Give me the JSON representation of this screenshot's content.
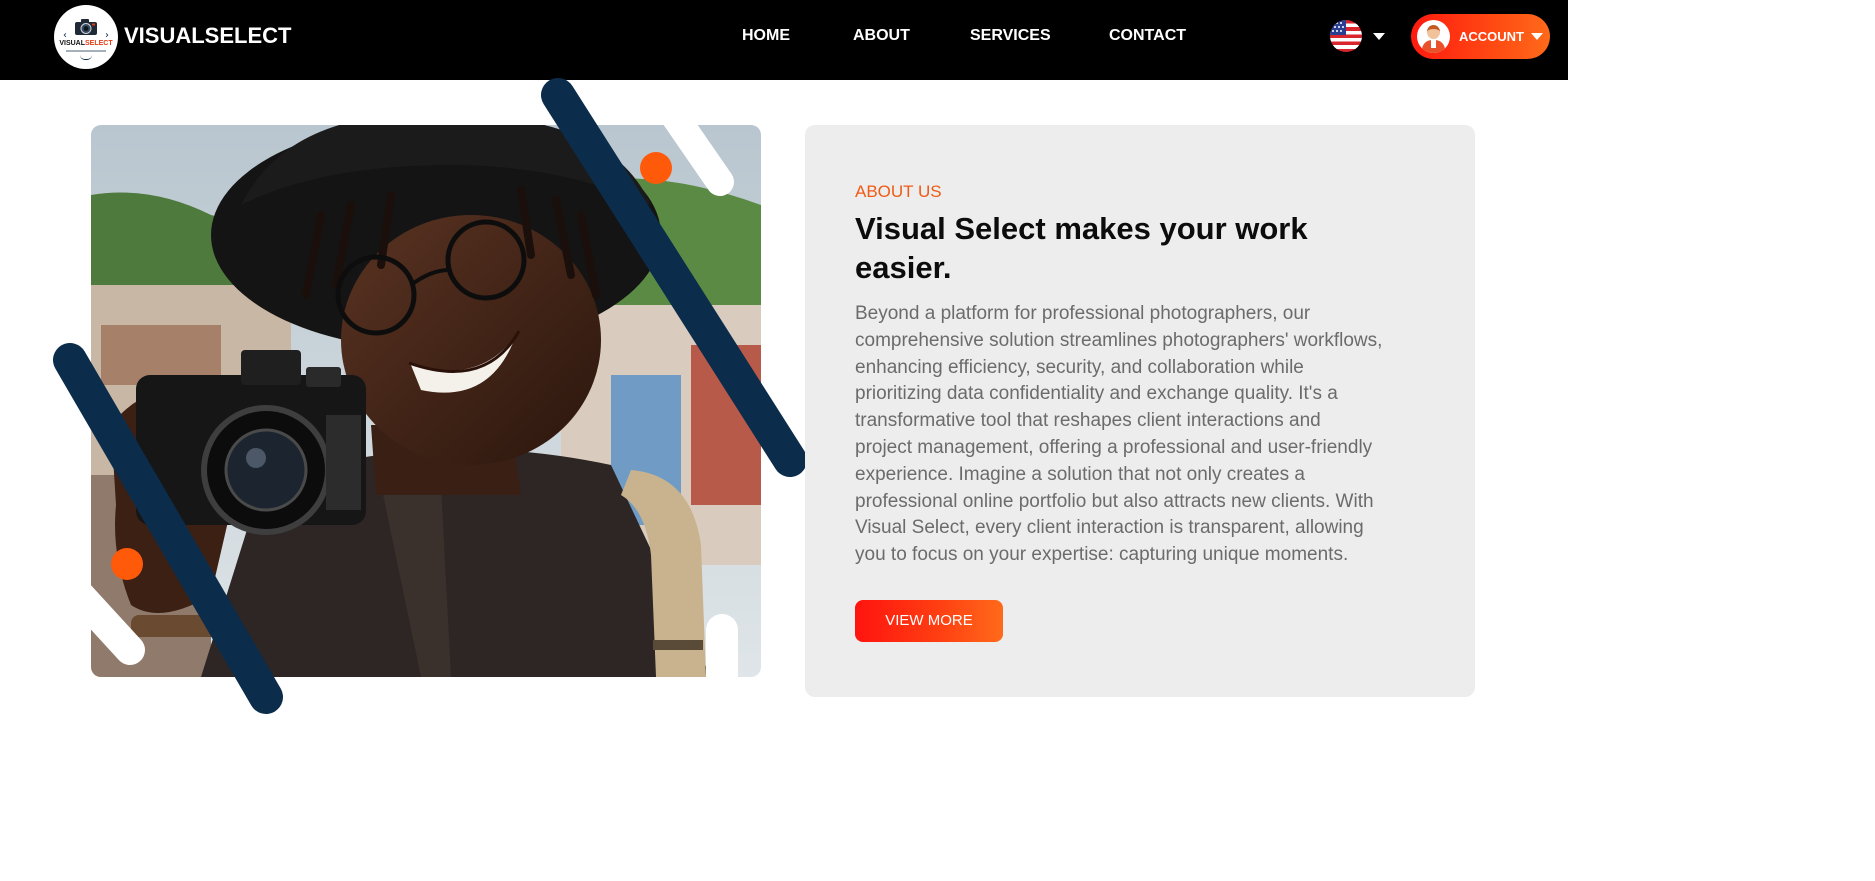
{
  "navbar": {
    "brand": "VISUALSELECT",
    "logo": {
      "line1_dark": "VISUAL",
      "line1_red": "SELECT",
      "icon": "camera-logo-icon"
    },
    "links": [
      {
        "label": "HOME"
      },
      {
        "label": "ABOUT"
      },
      {
        "label": "SERVICES"
      },
      {
        "label": "CONTACT"
      }
    ],
    "language": {
      "icon": "us-flag-icon",
      "dropdown_icon": "caret-down-icon"
    },
    "account": {
      "label": "ACCOUNT",
      "icon": "user-avatar-icon",
      "dropdown_icon": "caret-down-icon"
    }
  },
  "hero_image": {
    "icon": "photographer-photo"
  },
  "about": {
    "eyebrow": "ABOUT US",
    "headline_line1": "Visual Select makes your work",
    "headline_line2": "easier.",
    "body_lines": [
      "Beyond a platform for professional photographers, our",
      "comprehensive solution streamlines photographers' workflows,",
      "enhancing efficiency, security, and collaboration while",
      "prioritizing data confidentiality and exchange quality. It's a",
      "transformative tool that reshapes client interactions and",
      "project management, offering a professional and user-friendly",
      "experience. Imagine a solution that not only creates a",
      "professional online portfolio but also attracts new clients. With",
      "Visual Select, every client interaction is transparent, allowing",
      "you to focus on your expertise: capturing unique moments."
    ],
    "button_label": "VIEW MORE"
  },
  "colors": {
    "navbar_bg": "#000000",
    "accent_orange": "#ef5a14",
    "accent_red": "#ff140f",
    "navy_stripe": "#0b2c4a",
    "card_bg": "#ededed",
    "body_text": "#6b6b6b"
  }
}
